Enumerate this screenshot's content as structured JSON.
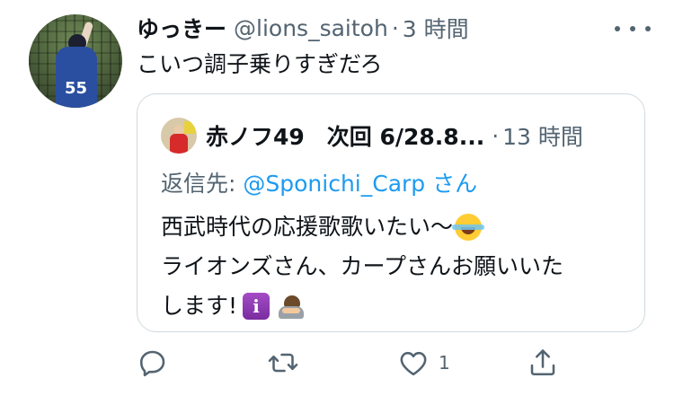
{
  "author": {
    "display_name": "ゆっきー",
    "handle": "@lions_saitoh",
    "separator": "·",
    "time": "3 時間",
    "avatar_number": "55"
  },
  "tweet_text": "こいつ調子乗りすぎだろ",
  "quoted": {
    "display_name": "赤ノフ49　次回 6/28.8...",
    "separator": "·",
    "time": "13 時間",
    "reply_prefix": "返信先: ",
    "reply_mention": "@Sponichi_Carp",
    "reply_suffix": " さん",
    "lines": [
      "西武時代の応援歌歌いたい〜",
      "ライオンズさん、カープさんお願いいた",
      "します!"
    ],
    "emoji_info_glyph": "i"
  },
  "actions": {
    "like_count": "1"
  },
  "icons": [
    "reply-icon",
    "retweet-icon",
    "like-icon",
    "share-icon",
    "more-icon"
  ],
  "colors": {
    "text": "#0f1419",
    "secondary": "#536471",
    "link": "#1d9bf0",
    "border": "#cfd9de"
  }
}
